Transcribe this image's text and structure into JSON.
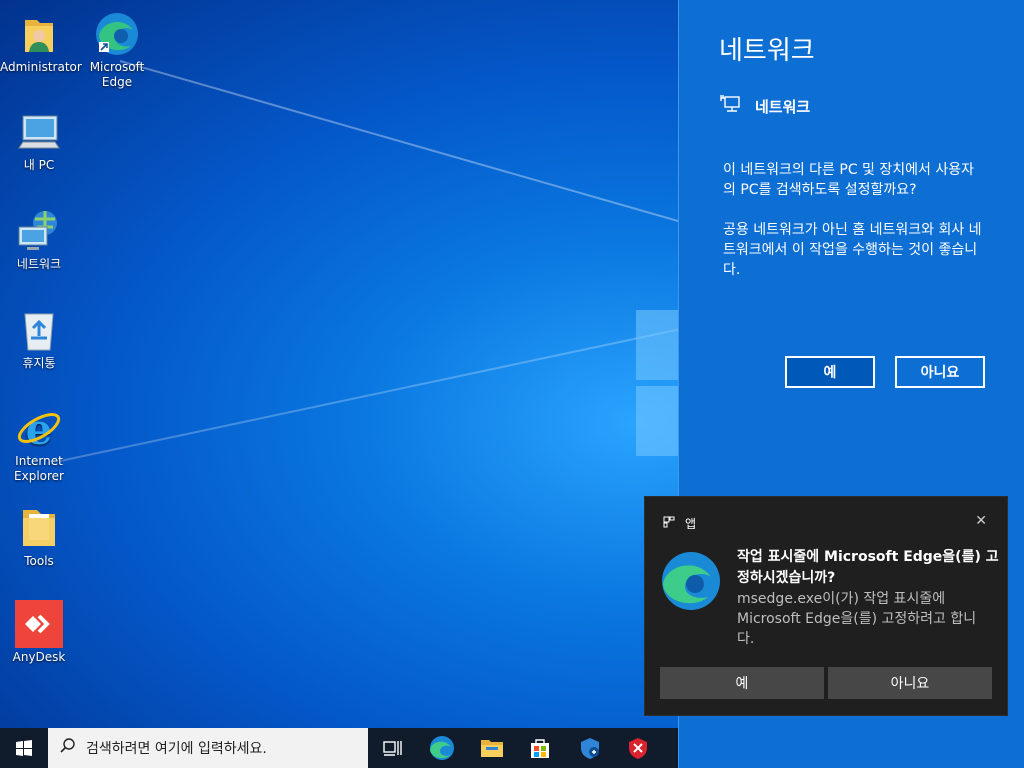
{
  "desktop": {
    "icons": [
      {
        "label": "Administrator"
      },
      {
        "label": "Microsoft Edge"
      },
      {
        "label": "내 PC"
      },
      {
        "label": "네트워크"
      },
      {
        "label": "휴지통"
      },
      {
        "label": "Internet Explorer"
      },
      {
        "label": "Tools"
      },
      {
        "label": "AnyDesk"
      }
    ]
  },
  "network_panel": {
    "title": "네트워크",
    "subtitle": "네트워크",
    "paragraph1": "이 네트워크의 다른 PC 및 장치에서 사용자의 PC를 검색하도록 설정할까요?",
    "paragraph2": "공용 네트워크가 아닌 홈 네트워크와 회사 네트워크에서 이 작업을 수행하는 것이 좋습니다.",
    "yes_label": "예",
    "no_label": "아니요"
  },
  "toast": {
    "app_label": "앱",
    "close_glyph": "✕",
    "title": "작업 표시줄에 Microsoft Edge을(를) 고정하시겠습니까?",
    "body": "msedge.exe이(가) 작업 표시줄에 Microsoft Edge을(를) 고정하려고 합니다.",
    "yes_label": "예",
    "no_label": "아니요"
  },
  "taskbar": {
    "search_placeholder": "검색하려면 여기에 입력하세요.",
    "icons": [
      "task-view-icon",
      "edge-icon",
      "file-explorer-icon",
      "store-icon",
      "defender-icon",
      "antivirus-shield-icon"
    ]
  }
}
